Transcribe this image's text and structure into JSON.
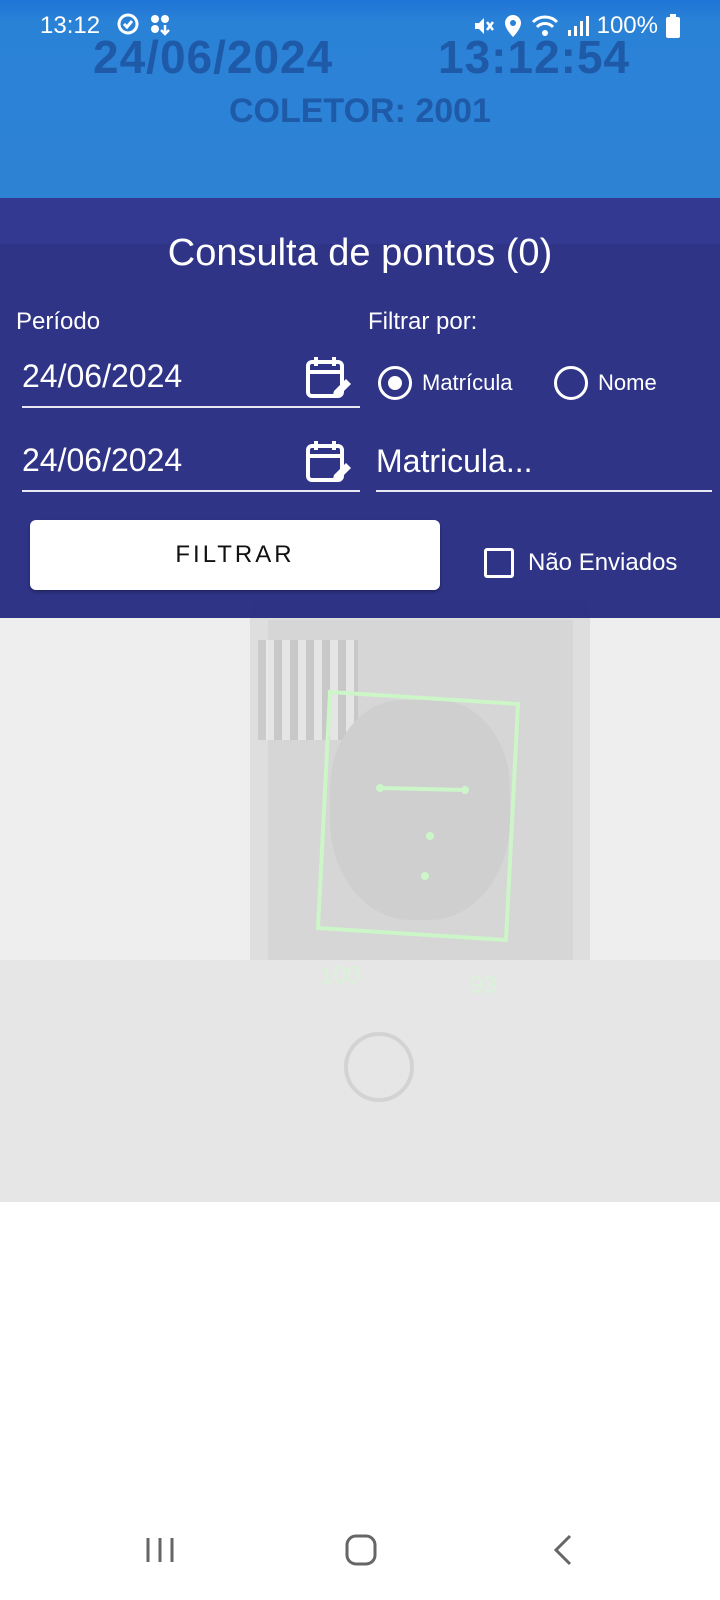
{
  "status_bar": {
    "time": "13:12",
    "battery": "100%",
    "icons": [
      "sync-icon",
      "app-icon",
      "mute-icon",
      "location-icon",
      "wifi-icon",
      "signal-icon",
      "battery-icon"
    ]
  },
  "header": {
    "date": "24/06/2024",
    "time": "13:12:54",
    "coletor": "COLETOR: 2001"
  },
  "panel": {
    "title": "Consulta de pontos (0)",
    "periodo_label": "Período",
    "filtrar_por_label": "Filtrar por:",
    "date_start": "24/06/2024",
    "date_end": "24/06/2024",
    "radio_matricula": "Matrícula",
    "radio_nome": "Nome",
    "radio_selected": "Matrícula",
    "matricula_placeholder": "Matricula...",
    "filter_button": "FILTRAR",
    "nao_enviados": "Não Enviados"
  },
  "camera": {
    "score_left": "100",
    "score_right": "93"
  },
  "colors": {
    "header_blue": "#2e82d4",
    "panel_blue": "#262c82",
    "text_white": "#ffffff"
  }
}
